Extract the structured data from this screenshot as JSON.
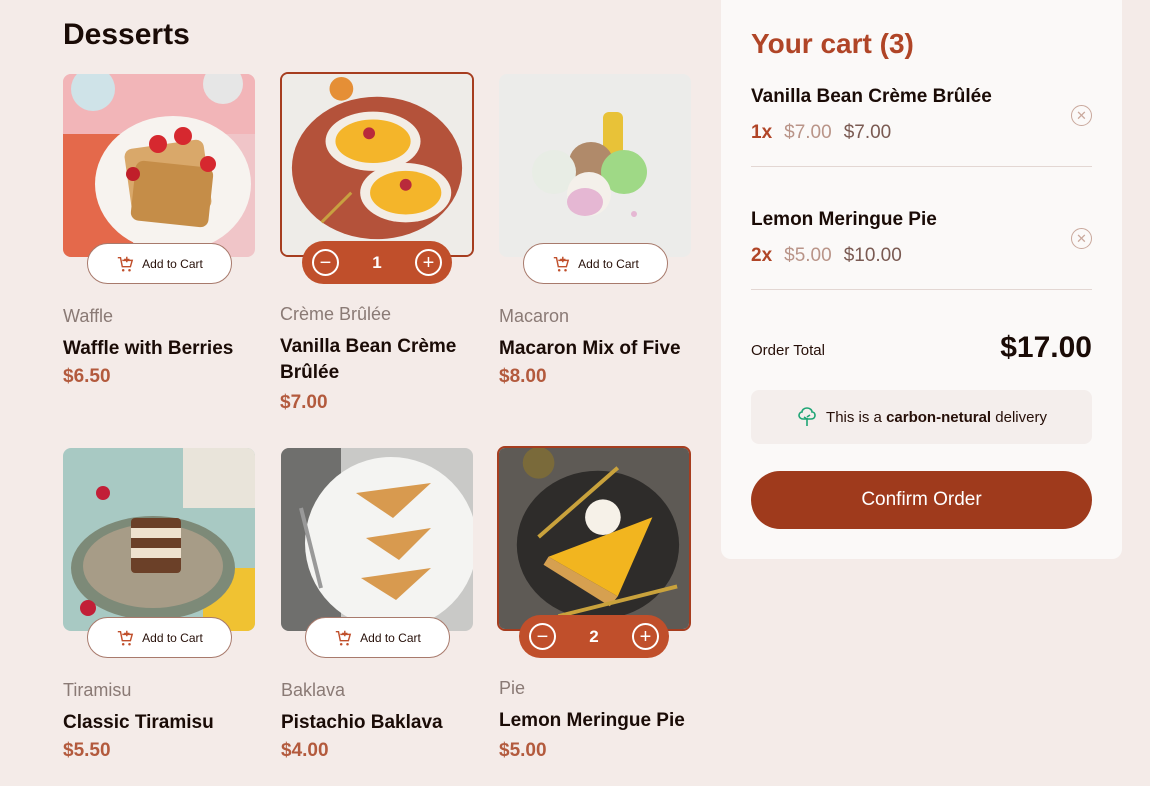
{
  "heading": "Desserts",
  "add_to_cart_label": "Add to Cart",
  "products": [
    {
      "category": "Waffle",
      "name": "Waffle with Berries",
      "price": "$6.50"
    },
    {
      "category": "Crème Brûlée",
      "name": "Vanilla Bean Crème Brûlée",
      "price": "$7.00",
      "quantity": "1"
    },
    {
      "category": "Macaron",
      "name": "Macaron Mix of Five",
      "price": "$8.00"
    },
    {
      "category": "Tiramisu",
      "name": "Classic Tiramisu",
      "price": "$5.50"
    },
    {
      "category": "Baklava",
      "name": "Pistachio Baklava",
      "price": "$4.00"
    },
    {
      "category": "Pie",
      "name": "Lemon Meringue Pie",
      "price": "$5.00",
      "quantity": "2"
    }
  ],
  "cart": {
    "title": "Your cart (3)",
    "items": [
      {
        "name": "Vanilla Bean Crème Brûlée",
        "qty": "1x",
        "unit": "$7.00",
        "total": "$7.00"
      },
      {
        "name": "Lemon Meringue Pie",
        "qty": "2x",
        "unit": "$5.00",
        "total": "$10.00"
      }
    ],
    "order_total_label": "Order Total",
    "order_total_value": "$17.00",
    "carbon_prefix": "This is a",
    "carbon_bold": "carbon-netural",
    "carbon_suffix": "delivery",
    "confirm_label": "Confirm Order"
  },
  "icons": {
    "cart_add": "cart-plus-icon",
    "minus": "minus-circle-icon",
    "plus": "plus-circle-icon",
    "remove": "remove-circle-icon",
    "tree": "tree-icon"
  },
  "colors": {
    "accent": "#c04f2b",
    "accent_dark": "#9f3a1c",
    "background": "#f4ebe8",
    "carbon_icon": "#1ea575"
  }
}
